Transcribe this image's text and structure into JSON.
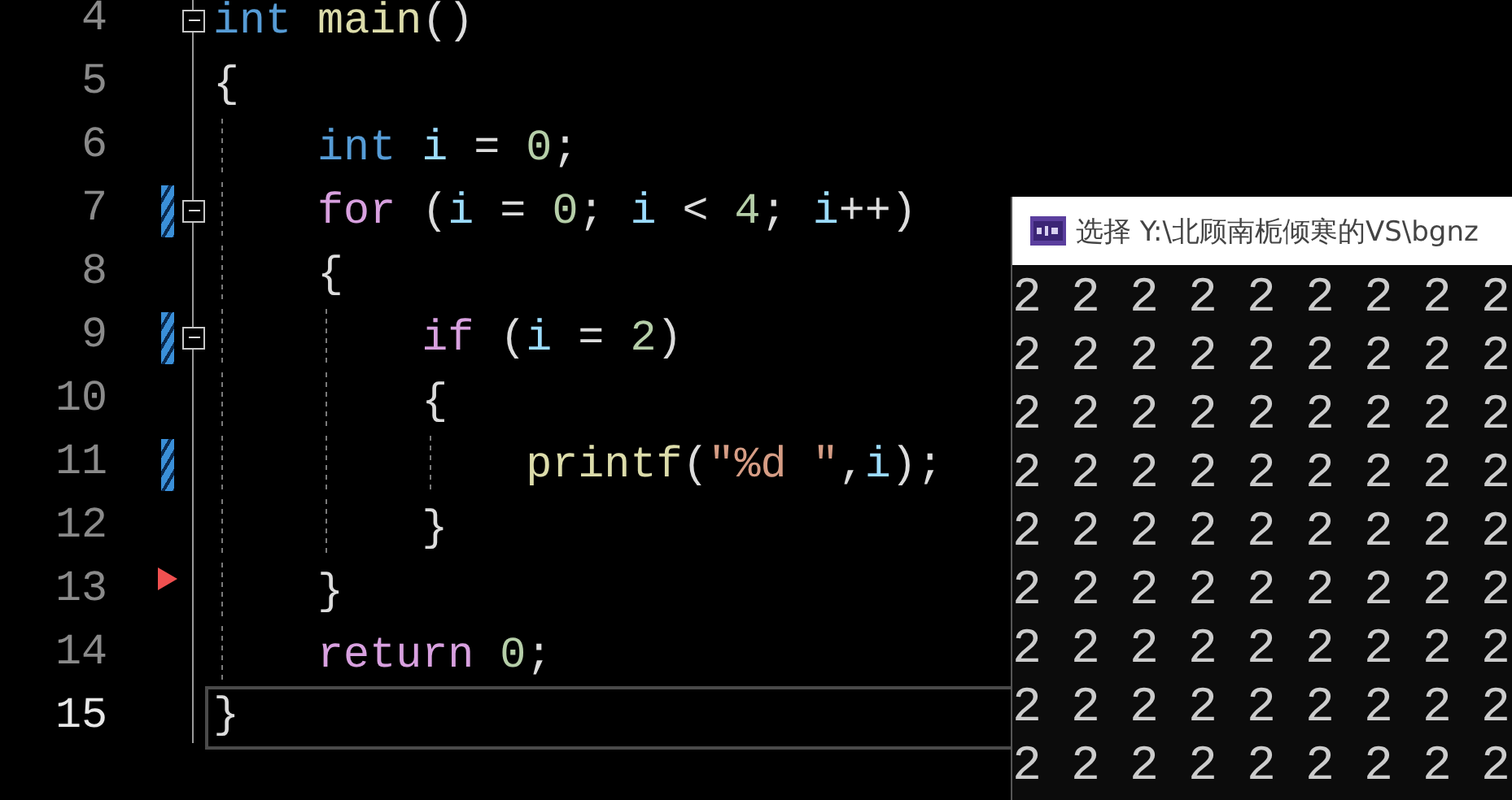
{
  "editor": {
    "lines": [
      {
        "number": "4",
        "fold": true,
        "changed": false,
        "arrow": false,
        "current": false,
        "tokens": [
          {
            "kind": "keyword",
            "text": "int"
          },
          {
            "kind": "function",
            "text": " main"
          },
          {
            "kind": "punct",
            "text": "()"
          }
        ]
      },
      {
        "number": "5",
        "fold": false,
        "changed": false,
        "arrow": false,
        "current": false,
        "tokens": [
          {
            "kind": "punct",
            "text": "{"
          }
        ]
      },
      {
        "number": "6",
        "fold": false,
        "changed": false,
        "arrow": false,
        "current": false,
        "tokens": [
          {
            "kind": "keyword",
            "text": "    int"
          },
          {
            "kind": "variable",
            "text": " i"
          },
          {
            "kind": "punct",
            "text": " = "
          },
          {
            "kind": "number",
            "text": "0"
          },
          {
            "kind": "punct",
            "text": ";"
          }
        ]
      },
      {
        "number": "7",
        "fold": true,
        "changed": true,
        "arrow": false,
        "current": false,
        "tokens": [
          {
            "kind": "control",
            "text": "    for"
          },
          {
            "kind": "punct",
            "text": " ("
          },
          {
            "kind": "variable",
            "text": "i"
          },
          {
            "kind": "punct",
            "text": " = "
          },
          {
            "kind": "number",
            "text": "0"
          },
          {
            "kind": "punct",
            "text": "; "
          },
          {
            "kind": "variable",
            "text": "i"
          },
          {
            "kind": "punct",
            "text": " < "
          },
          {
            "kind": "number",
            "text": "4"
          },
          {
            "kind": "punct",
            "text": "; "
          },
          {
            "kind": "variable",
            "text": "i"
          },
          {
            "kind": "punct",
            "text": "++)"
          }
        ]
      },
      {
        "number": "8",
        "fold": false,
        "changed": false,
        "arrow": false,
        "current": false,
        "tokens": [
          {
            "kind": "punct",
            "text": "    {"
          }
        ]
      },
      {
        "number": "9",
        "fold": true,
        "changed": true,
        "arrow": false,
        "current": false,
        "tokens": [
          {
            "kind": "control",
            "text": "        if"
          },
          {
            "kind": "punct",
            "text": " ("
          },
          {
            "kind": "variable",
            "text": "i"
          },
          {
            "kind": "punct",
            "text": " = "
          },
          {
            "kind": "number",
            "text": "2"
          },
          {
            "kind": "punct",
            "text": ")"
          }
        ]
      },
      {
        "number": "10",
        "fold": false,
        "changed": false,
        "arrow": false,
        "current": false,
        "tokens": [
          {
            "kind": "punct",
            "text": "        {"
          }
        ]
      },
      {
        "number": "11",
        "fold": false,
        "changed": true,
        "arrow": false,
        "current": false,
        "tokens": [
          {
            "kind": "function",
            "text": "            printf"
          },
          {
            "kind": "punct",
            "text": "("
          },
          {
            "kind": "string",
            "text": "\"%d \""
          },
          {
            "kind": "punct",
            "text": ","
          },
          {
            "kind": "variable",
            "text": "i"
          },
          {
            "kind": "punct",
            "text": ");"
          }
        ]
      },
      {
        "number": "12",
        "fold": false,
        "changed": false,
        "arrow": false,
        "current": false,
        "tokens": [
          {
            "kind": "punct",
            "text": "        }"
          }
        ]
      },
      {
        "number": "13",
        "fold": false,
        "changed": false,
        "arrow": true,
        "current": false,
        "tokens": [
          {
            "kind": "punct",
            "text": "    }"
          }
        ]
      },
      {
        "number": "14",
        "fold": false,
        "changed": false,
        "arrow": false,
        "current": false,
        "tokens": [
          {
            "kind": "control",
            "text": "    return"
          },
          {
            "kind": "number",
            "text": " 0"
          },
          {
            "kind": "punct",
            "text": ";"
          }
        ]
      },
      {
        "number": "15",
        "fold": false,
        "changed": false,
        "arrow": false,
        "current": true,
        "tokens": [
          {
            "kind": "punct",
            "text": "}"
          }
        ]
      }
    ]
  },
  "console": {
    "title": "选择 Y:\\北顾南栀倾寒的VS\\bgnz",
    "output": [
      "2 2 2 2 2 2 2 2 2",
      "2 2 2 2 2 2 2 2 2",
      "2 2 2 2 2 2 2 2 2",
      "2 2 2 2 2 2 2 2 2",
      "2 2 2 2 2 2 2 2 2",
      "2 2 2 2 2 2 2 2 2",
      "2 2 2 2 2 2 2 2 2",
      "2 2 2 2 2 2 2 2 2",
      "2 2 2 2 2 2 2 2 2"
    ]
  }
}
